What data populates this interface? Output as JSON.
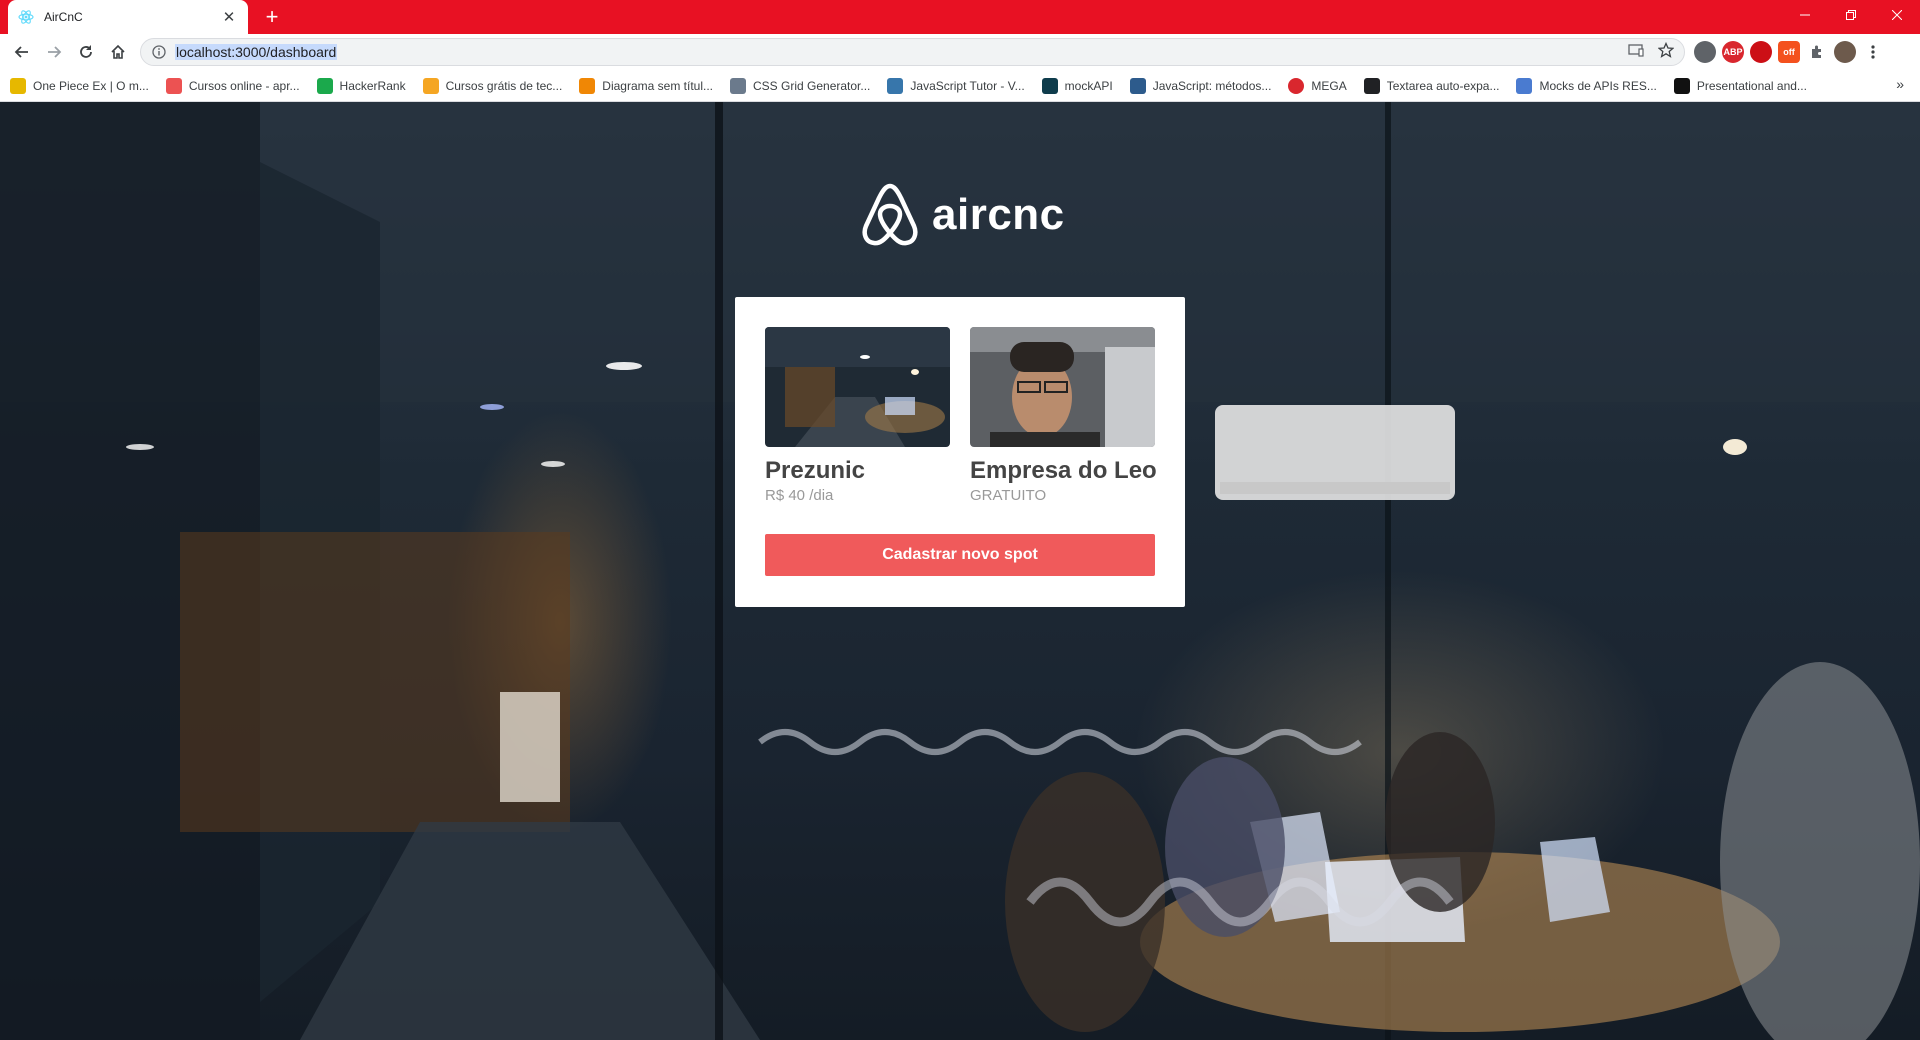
{
  "browser": {
    "tab_title": "AirCnC",
    "url": "localhost:3000/dashboard",
    "bookmarks": [
      {
        "label": "One Piece Ex | O m...",
        "color": "#e6b800"
      },
      {
        "label": "Cursos online - apr...",
        "color": "#ec5252"
      },
      {
        "label": "HackerRank",
        "color": "#1ba94c"
      },
      {
        "label": "Cursos grátis de tec...",
        "color": "#f5a623"
      },
      {
        "label": "Diagrama sem títul...",
        "color": "#f08705"
      },
      {
        "label": "CSS Grid Generator...",
        "color": "#6b7a8c"
      },
      {
        "label": "JavaScript Tutor - V...",
        "color": "#3776ab"
      },
      {
        "label": "mockAPI",
        "color": "#0f3c4c"
      },
      {
        "label": "JavaScript: métodos...",
        "color": "#2d5b8c"
      },
      {
        "label": "MEGA",
        "color": "#d9272e"
      },
      {
        "label": "Textarea auto-expa...",
        "color": "#202124"
      },
      {
        "label": "Mocks de APIs RES...",
        "color": "#4a7bd0"
      },
      {
        "label": "Presentational and...",
        "color": "#111111"
      }
    ],
    "extensions": [
      {
        "label": "",
        "color": "#5f6368"
      },
      {
        "label": "ABP",
        "color": "#d9272e"
      },
      {
        "label": "",
        "color": "#cc0f16"
      },
      {
        "label": "off",
        "color": "#f4511e"
      }
    ]
  },
  "app": {
    "brand": "aircnc",
    "spots": [
      {
        "name": "Prezunic",
        "price": "R$ 40 /dia"
      },
      {
        "name": "Empresa do Leo",
        "price": "GRATUITO"
      }
    ],
    "cta_label": "Cadastrar novo spot",
    "accent": "#f05a5b"
  }
}
